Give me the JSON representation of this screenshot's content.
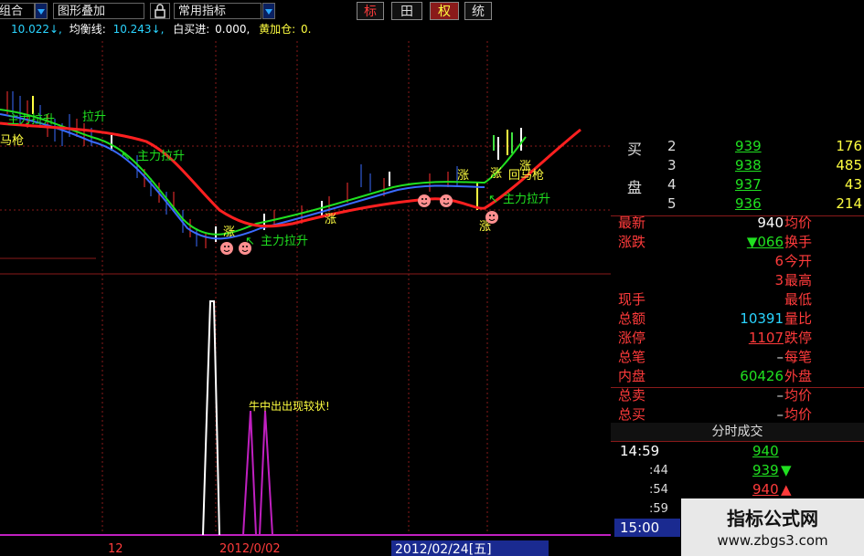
{
  "toolbar": {
    "combo_label": "组合",
    "overlay_label": "图形叠加",
    "indicator_label": "常用指标",
    "tabs": [
      "标",
      "田",
      "权",
      "统"
    ]
  },
  "indicator_line": {
    "price": "10.022↓,",
    "balance_label": "均衡线:",
    "balance_value": "10.243↓,",
    "buyin_label": "白买进:",
    "buyin_value": "0.000,",
    "addpos_label": "黄加仓:",
    "addpos_value": "0."
  },
  "chart_labels": {
    "pull_up_1": "主力拉升",
    "pull_up_2": "主力拉升",
    "pull_up_3": "主力拉升",
    "pull_up_4": "主力拉升",
    "zhang_1": "涨",
    "zhang_2": "涨",
    "zhang_3": "涨",
    "zhang_4": "涨",
    "zhang_5": "涨",
    "return_gun": "回马枪",
    "xiong_text": "牛中出出现较状!",
    "date_left": "12",
    "date_mid": "2012/0/02",
    "date_right": "2012/02/24[五]"
  },
  "order_book": {
    "buy_label_1": "买",
    "buy_label_2": "盘",
    "levels": [
      {
        "idx": "2",
        "price": "939",
        "vol": "176"
      },
      {
        "idx": "3",
        "price": "938",
        "vol": "485"
      },
      {
        "idx": "4",
        "price": "937",
        "vol": "43"
      },
      {
        "idx": "5",
        "price": "936",
        "vol": "214"
      }
    ]
  },
  "quote": [
    {
      "label": "最新",
      "value": "940",
      "right": "均价"
    },
    {
      "label": "涨跌",
      "value": "▼066",
      "right": "换手"
    },
    {
      "label": "",
      "value": "6",
      "right": "今开"
    },
    {
      "label": "",
      "value": "3",
      "right": "最高"
    },
    {
      "label": "现手",
      "value": "",
      "right": "最低"
    },
    {
      "label": "总额",
      "value": "10391",
      "right": "量比"
    },
    {
      "label": "涨停",
      "value": "1107",
      "right": "跌停"
    },
    {
      "label": "总笔",
      "value": "–",
      "right": "每笔"
    },
    {
      "label": "内盘",
      "value": "60426",
      "right": "外盘"
    },
    {
      "label": "总卖",
      "value": "–",
      "right": "均价"
    },
    {
      "label": "总买",
      "value": "–",
      "right": "均价"
    }
  ],
  "ticks": {
    "title": "分时成交",
    "rows": [
      {
        "time": "14:59",
        "price": "940",
        "arrow": ""
      },
      {
        "time": ":44",
        "price": "939",
        "arrow": "down"
      },
      {
        "time": ":54",
        "price": "940",
        "arrow": "up"
      },
      {
        "time": ":59",
        "price": "",
        "arrow": ""
      },
      {
        "time": "15:00",
        "price": "",
        "arrow": ""
      }
    ]
  },
  "watermark": {
    "title": "指标公式网",
    "url": "www.zbgs3.com"
  }
}
